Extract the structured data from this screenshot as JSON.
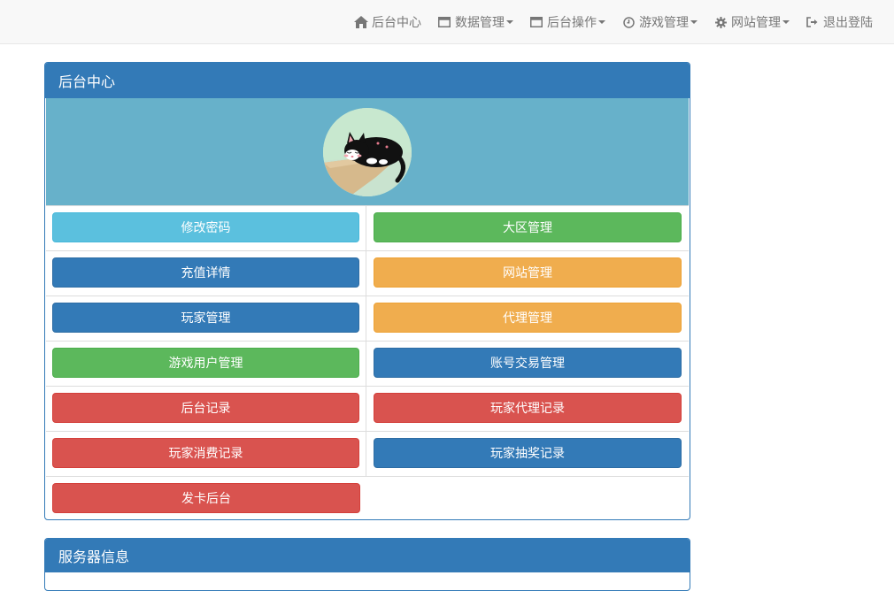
{
  "nav": {
    "items": [
      {
        "label": "后台中心",
        "icon": "home-icon",
        "dropdown": false
      },
      {
        "label": "数据管理",
        "icon": "window-icon",
        "dropdown": true
      },
      {
        "label": "后台操作",
        "icon": "window-icon",
        "dropdown": true
      },
      {
        "label": "游戏管理",
        "icon": "clock-icon",
        "dropdown": true
      },
      {
        "label": "网站管理",
        "icon": "gear-icon",
        "dropdown": true
      },
      {
        "label": "退出登陆",
        "icon": "logout-icon",
        "dropdown": false
      }
    ]
  },
  "panel": {
    "title": "后台中心",
    "avatar": "sleeping-cat-avatar",
    "buttons": [
      {
        "label": "修改密码",
        "color": "#5bc0de"
      },
      {
        "label": "大区管理",
        "color": "#5cb85c"
      },
      {
        "label": "充值详情",
        "color": "#337ab7"
      },
      {
        "label": "网站管理",
        "color": "#f0ad4e"
      },
      {
        "label": "玩家管理",
        "color": "#337ab7"
      },
      {
        "label": "代理管理",
        "color": "#f0ad4e"
      },
      {
        "label": "游戏用户管理",
        "color": "#5cb85c"
      },
      {
        "label": "账号交易管理",
        "color": "#337ab7"
      },
      {
        "label": "后台记录",
        "color": "#d9534f"
      },
      {
        "label": "玩家代理记录",
        "color": "#d9534f"
      },
      {
        "label": "玩家消费记录",
        "color": "#d9534f"
      },
      {
        "label": "玩家抽奖记录",
        "color": "#337ab7"
      },
      {
        "label": "发卡后台",
        "color": "#d9534f"
      }
    ]
  },
  "panel2": {
    "title": "服务器信息"
  },
  "colors": {
    "primary": "#337ab7",
    "info": "#5bc0de",
    "success": "#5cb85c",
    "warning": "#f0ad4e",
    "danger": "#d9534f",
    "avatar_band": "#67b1ca"
  }
}
